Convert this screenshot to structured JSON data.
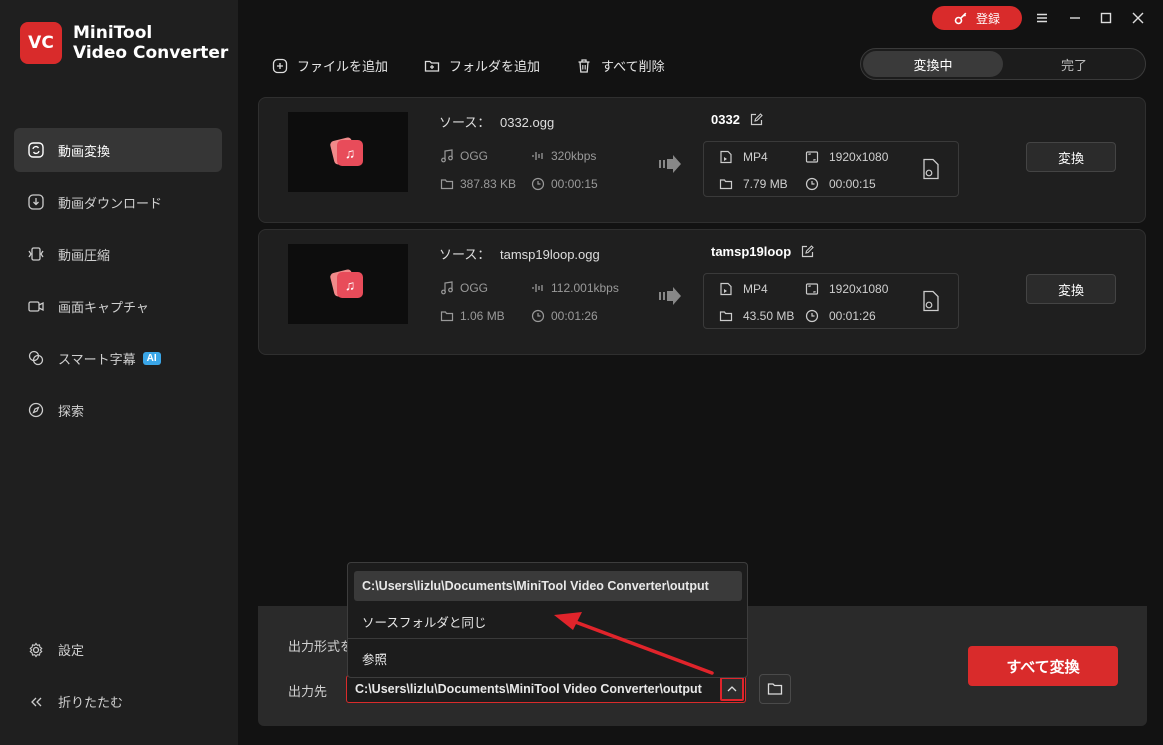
{
  "app": {
    "logo_badge": "VC",
    "logo_line1": "MiniTool",
    "logo_line2": "Video Converter",
    "accent_color": "#d92b2b"
  },
  "titlebar": {
    "login_label": "登録"
  },
  "sidebar": {
    "items": [
      {
        "label": "動画変換",
        "icon": "convert-icon",
        "active": true
      },
      {
        "label": "動画ダウンロード",
        "icon": "download-icon"
      },
      {
        "label": "動画圧縮",
        "icon": "compress-icon"
      },
      {
        "label": "画面キャプチャ",
        "icon": "camera-icon"
      },
      {
        "label": "スマート字幕",
        "icon": "subtitle-icon",
        "badge": "AI"
      },
      {
        "label": "探索",
        "icon": "compass-icon"
      }
    ],
    "settings_label": "設定",
    "collapse_label": "折りたたむ"
  },
  "toolbar": {
    "add_file": "ファイルを追加",
    "add_folder": "フォルダを追加",
    "delete_all": "すべて削除"
  },
  "tabs": {
    "converting": "変換中",
    "done": "完了"
  },
  "files": [
    {
      "source_prefix": "ソース：",
      "source_name": "0332.ogg",
      "src_format": "OGG",
      "src_bitrate": "320kbps",
      "src_size": "387.83 KB",
      "src_duration": "00:00:15",
      "output_name": "0332",
      "out_format": "MP4",
      "out_resolution": "1920x1080",
      "out_size": "7.79 MB",
      "out_duration": "00:00:15",
      "convert_label": "変換"
    },
    {
      "source_prefix": "ソース：",
      "source_name": "tamsp19loop.ogg",
      "src_format": "OGG",
      "src_bitrate": "112.001kbps",
      "src_size": "1.06 MB",
      "src_duration": "00:01:26",
      "output_name": "tamsp19loop",
      "out_format": "MP4",
      "out_resolution": "1920x1080",
      "out_size": "43.50 MB",
      "out_duration": "00:01:26",
      "convert_label": "変換"
    }
  ],
  "bottom": {
    "output_format_label": "出力形式を",
    "output_dest_label": "出力先",
    "output_path": "C:\\Users\\lizlu\\Documents\\MiniTool Video Converter\\output",
    "convert_all_label": "すべて変換"
  },
  "dropdown": {
    "options": [
      "C:\\Users\\lizlu\\Documents\\MiniTool Video Converter\\output",
      "ソースフォルダと同じ",
      "参照"
    ],
    "highlighted_index": 0
  }
}
